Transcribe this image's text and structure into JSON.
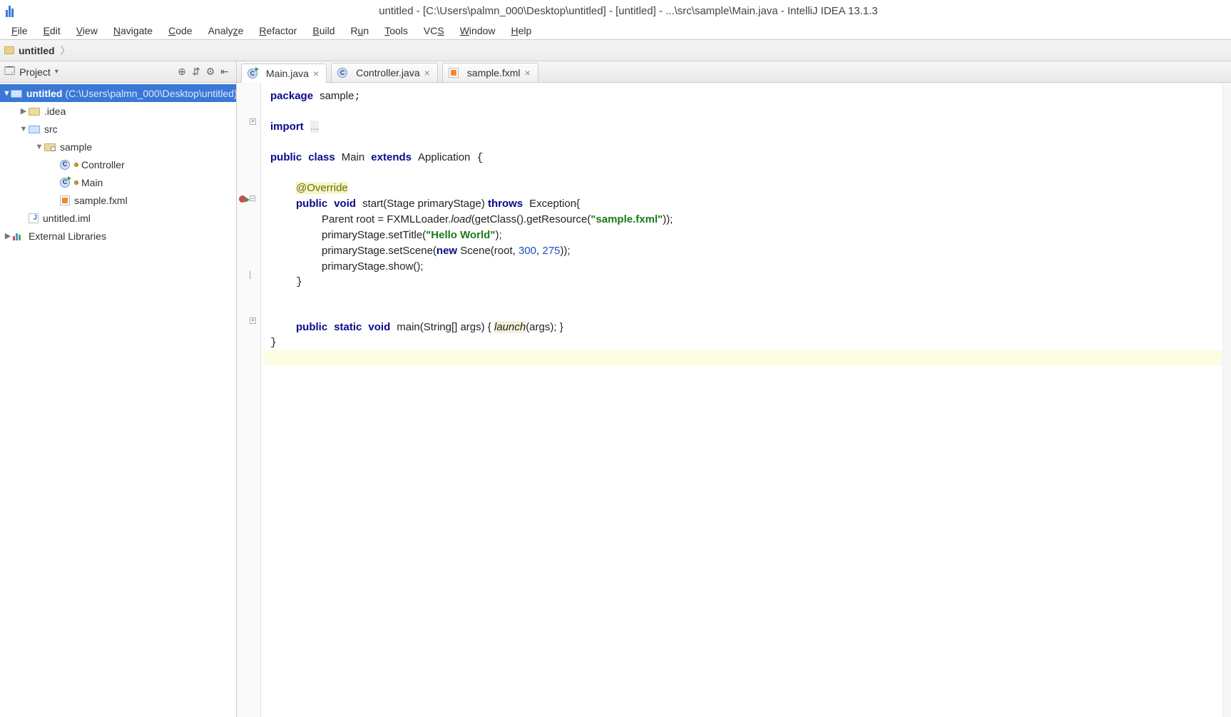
{
  "title": "untitled - [C:\\Users\\palmn_000\\Desktop\\untitled] - [untitled] - ...\\src\\sample\\Main.java - IntelliJ IDEA 13.1.3",
  "menu": [
    "File",
    "Edit",
    "View",
    "Navigate",
    "Code",
    "Analyze",
    "Refactor",
    "Build",
    "Run",
    "Tools",
    "VCS",
    "Window",
    "Help"
  ],
  "breadcrumb": {
    "project": "untitled"
  },
  "project_tool": {
    "title": "Project"
  },
  "tree": {
    "root": {
      "name": "untitled",
      "path": "(C:\\Users\\palmn_000\\Desktop\\untitled)"
    },
    "idea": ".idea",
    "src": "src",
    "sample": "sample",
    "controller": "Controller",
    "main": "Main",
    "fxml": "sample.fxml",
    "iml": "untitled.iml",
    "ext": "External Libraries"
  },
  "tabs": [
    {
      "name": "Main.java",
      "kind": "class-run",
      "active": true
    },
    {
      "name": "Controller.java",
      "kind": "class",
      "active": false
    },
    {
      "name": "sample.fxml",
      "kind": "fxml",
      "active": false
    }
  ],
  "code": {
    "package_kw": "package",
    "package_name": "sample",
    "import_kw": "import",
    "import_rest": "...",
    "line3": {
      "public": "public",
      "class": "class",
      "Main": "Main",
      "extends": "extends",
      "Application": "Application"
    },
    "override": "@Override",
    "line5": {
      "public": "public",
      "void": "void",
      "start": "start",
      "sig": "(Stage primaryStage) ",
      "throws": "throws",
      "exc": "Exception{"
    },
    "line6": {
      "a": "Parent root = FXMLLoader.",
      "load": "load",
      "b": "(getClass().getResource(",
      "s": "\"sample.fxml\"",
      "c": "));"
    },
    "line7": {
      "a": "primaryStage.setTitle(",
      "s": "\"Hello World\"",
      "b": ");"
    },
    "line8": {
      "a": "primaryStage.setScene(",
      "new": "new",
      "b": " Scene(root, ",
      "n1": "300",
      "c": ", ",
      "n2": "275",
      "d": "));"
    },
    "line9": "primaryStage.show();",
    "line12": {
      "public": "public",
      "static": "static",
      "void": "void",
      "main": "main",
      "sig": "(String[] args) { ",
      "launch": "launch",
      "rest": "(args); }"
    }
  }
}
